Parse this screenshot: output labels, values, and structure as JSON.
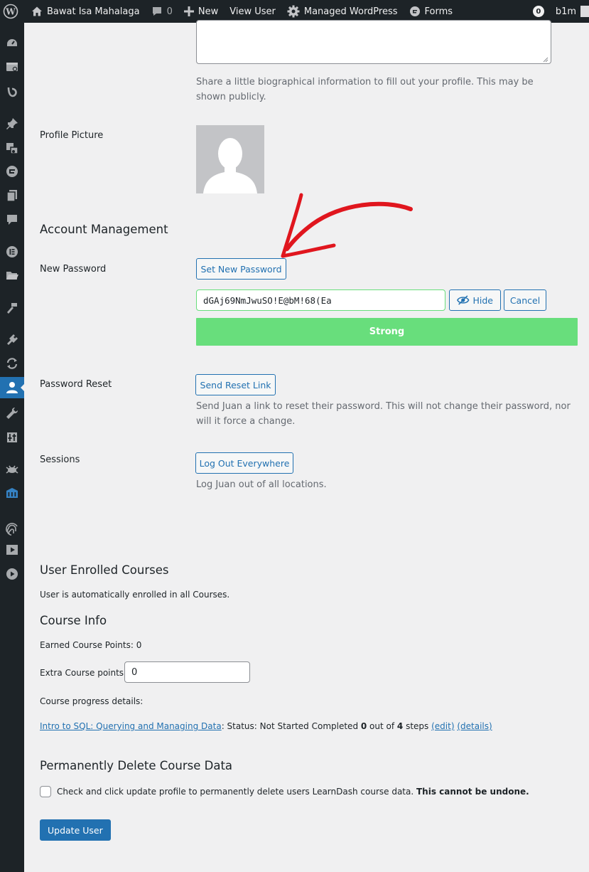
{
  "adminbar": {
    "site_name": "Bawat Isa Mahalaga",
    "comments_count": "0",
    "new_label": "New",
    "view_user_label": "View User",
    "managed_wp_label": "Managed WordPress",
    "forms_label": "Forms",
    "notifications_count": "0",
    "user_short": "b1m"
  },
  "bio": {
    "description": "Share a little biographical information to fill out your profile. This may be shown publicly."
  },
  "profile_picture": {
    "label": "Profile Picture"
  },
  "account_management": {
    "heading": "Account Management",
    "new_password_label": "New Password",
    "set_new_password_button": "Set New Password",
    "password_value": "dGAj69NmJwuSO!E@bM!68(Ea",
    "hide_button": "Hide",
    "cancel_button": "Cancel",
    "strength_text": "Strong",
    "password_reset_label": "Password Reset",
    "send_reset_link_button": "Send Reset Link",
    "reset_description": "Send Juan a link to reset their password. This will not change their password, nor will it force a change.",
    "sessions_label": "Sessions",
    "log_out_everywhere_button": "Log Out Everywhere",
    "sessions_description": "Log Juan out of all locations."
  },
  "enrolled": {
    "heading": "User Enrolled Courses",
    "text": "User is automatically enrolled in all Courses."
  },
  "course_info": {
    "heading": "Course Info",
    "earned_points_label": "Earned Course Points: 0",
    "extra_points_label": "Extra Course points",
    "extra_points_value": "0",
    "progress_label": "Course progress details:",
    "course_link": "Intro to SQL: Querying and Managing Data",
    "status_text": ": Status: Not Started Completed ",
    "completed": "0",
    "out_of_text": " out of ",
    "total": "4",
    "steps_text": " steps ",
    "edit_link": "(edit)",
    "details_link": "(details)"
  },
  "delete_data": {
    "heading": "Permanently Delete Course Data",
    "checkbox_label": "Check and click update profile to permanently delete users LearnDash course data. ",
    "warning": "This cannot be undone."
  },
  "update_button": "Update User",
  "colors": {
    "accent": "#2271b1",
    "strong": "#68de7c",
    "annotation": "#e0161e",
    "adminbar": "#1d2327"
  }
}
